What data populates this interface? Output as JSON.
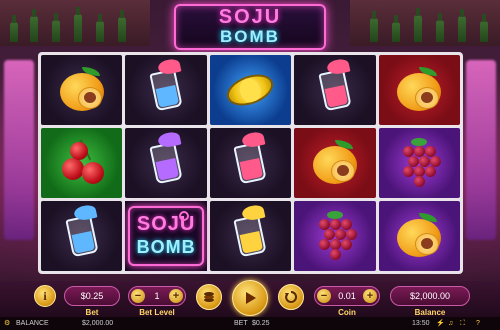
{
  "game": {
    "logo_line1": "SOJU",
    "logo_line2": "BOMB",
    "wild_line1": "SOJU",
    "wild_line2": "BOMB"
  },
  "reels": {
    "columns": [
      [
        "peach",
        "cherries",
        "glass-blue"
      ],
      [
        "glass-blue",
        "glass-purple",
        "wild-soju-bomb"
      ],
      [
        "starfruit",
        "glass-pink",
        "glass-yellow"
      ],
      [
        "glass-pink",
        "peach",
        "grapes"
      ],
      [
        "peach",
        "grapes",
        "peach"
      ]
    ],
    "backgrounds": [
      [
        "dark",
        "green",
        "dark"
      ],
      [
        "dark",
        "dark",
        "dark"
      ],
      [
        "blue",
        "dark",
        "dark"
      ],
      [
        "dark",
        "red",
        "purple"
      ],
      [
        "red",
        "purple",
        "purple"
      ]
    ]
  },
  "controls": {
    "info_icon": "i",
    "bet_value": "0.25",
    "bet_label": "Bet",
    "bet_level_value": "1",
    "bet_level_label": "Bet Level",
    "minus": "−",
    "plus": "+",
    "coin_value": "0.01",
    "coin_label": "Coin",
    "balance_value": "2,000.00",
    "balance_label": "Balance",
    "coin_icon": "coins-icon",
    "spin_icon": "play-icon",
    "autoplay_icon": "autoplay-icon"
  },
  "status_bar": {
    "balance_label": "BALANCE",
    "balance_value": "2,000.00",
    "bet_label": "BET",
    "bet_value": "0.25",
    "time": "13:50"
  },
  "colors": {
    "accent_pink": "#ff6ad5",
    "accent_cyan": "#9ff0ff",
    "gold": "#ffd76a"
  }
}
